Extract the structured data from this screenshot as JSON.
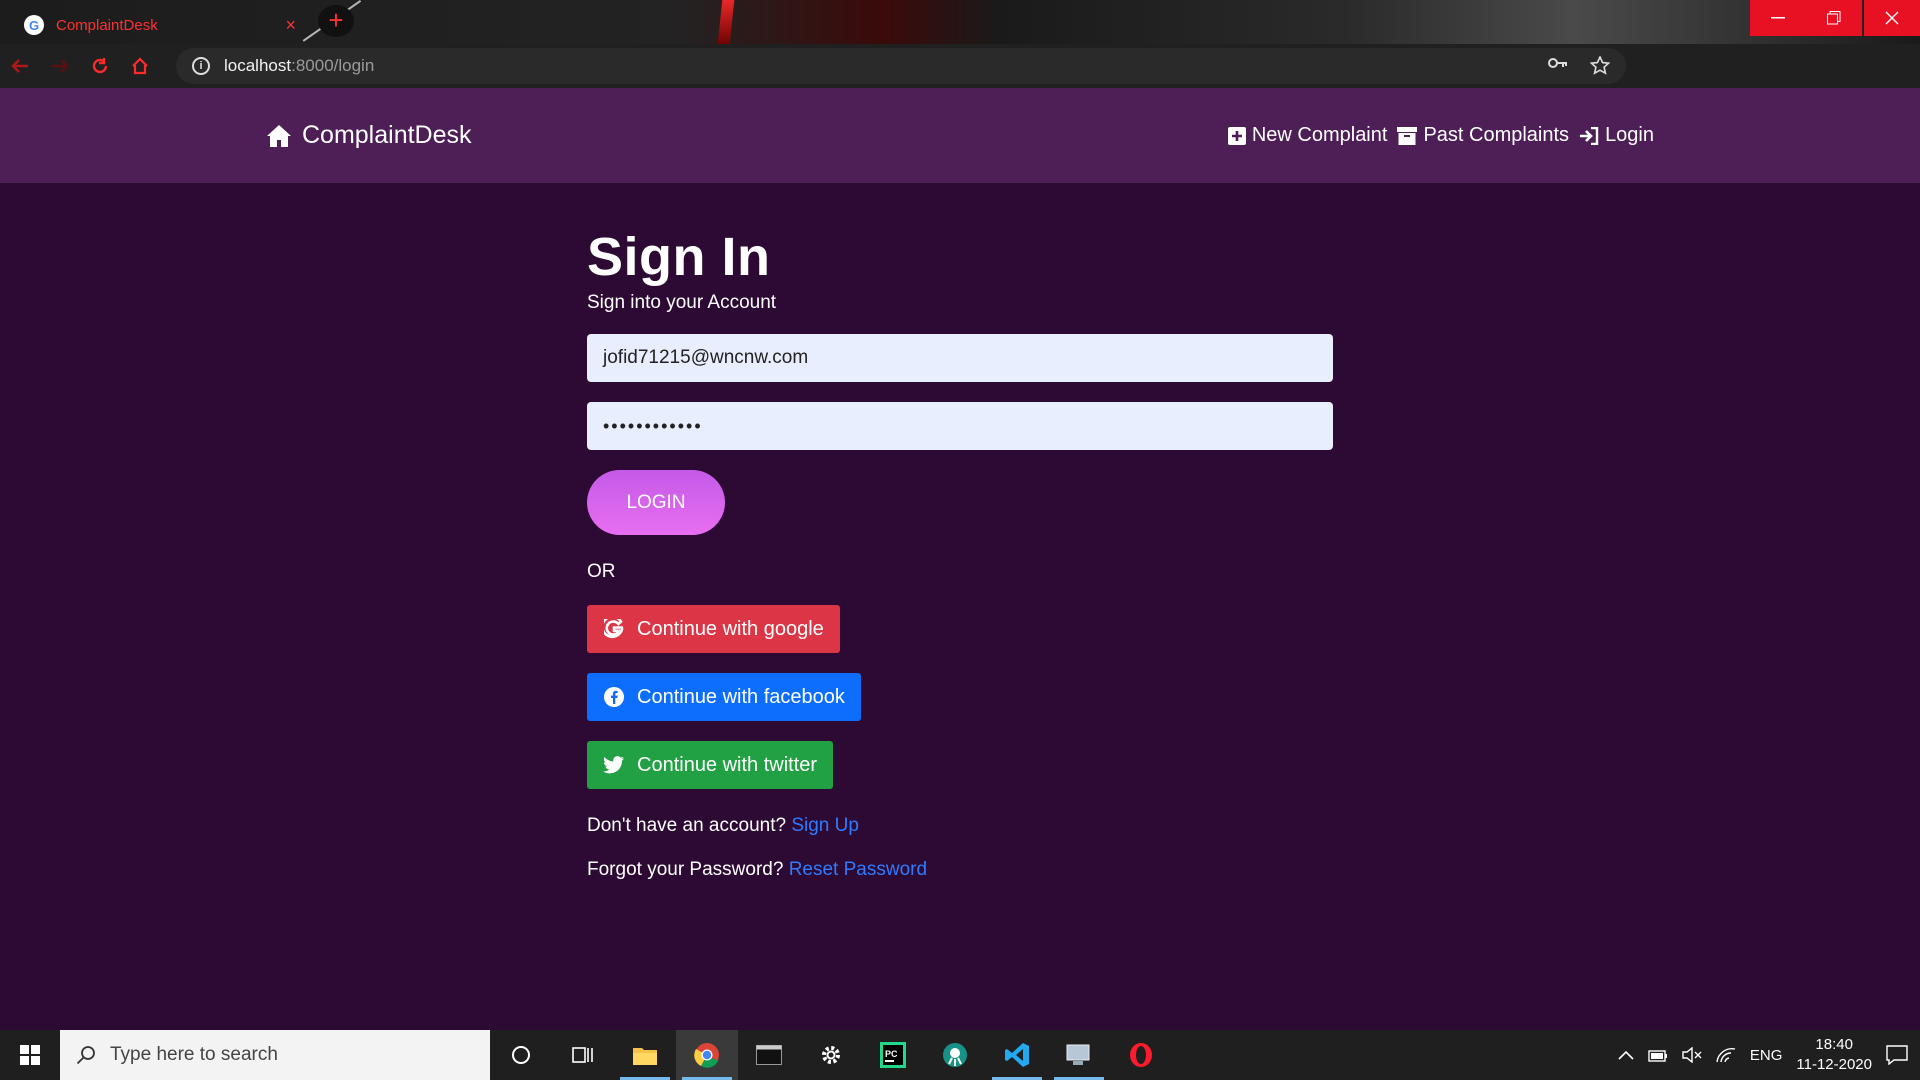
{
  "browser": {
    "tab_title": "ComplaintDesk",
    "tab_close": "×",
    "new_tab": "+",
    "url_host": "localhost",
    "url_path": ":8000/login"
  },
  "navbar": {
    "brand": "ComplaintDesk",
    "links": [
      "New Complaint",
      "Past Complaints",
      "Login"
    ]
  },
  "signin": {
    "title": "Sign In",
    "subtitle": "Sign into your Account",
    "email_value": "jofid71215@wncnw.com",
    "password_value": "••••••••••••",
    "login_label": "LOGIN",
    "or_label": "OR",
    "google_label": "Continue with google",
    "facebook_label": "Continue with facebook",
    "twitter_label": "Continue with twitter",
    "signup_prompt": "Don't have an account?",
    "signup_link": "Sign Up",
    "forgot_prompt": "Forgot your Password?",
    "forgot_link": "Reset Password"
  },
  "taskbar": {
    "search_placeholder": "Type here to search",
    "lang": "ENG",
    "time": "18:40",
    "date": "11-12-2020"
  },
  "colors": {
    "page_bg": "#2d0a33",
    "navbar_bg": "#4e1f57",
    "google": "#dc3545",
    "facebook": "#0d6efd",
    "twitter": "#21a143",
    "link": "#2f7bff"
  }
}
